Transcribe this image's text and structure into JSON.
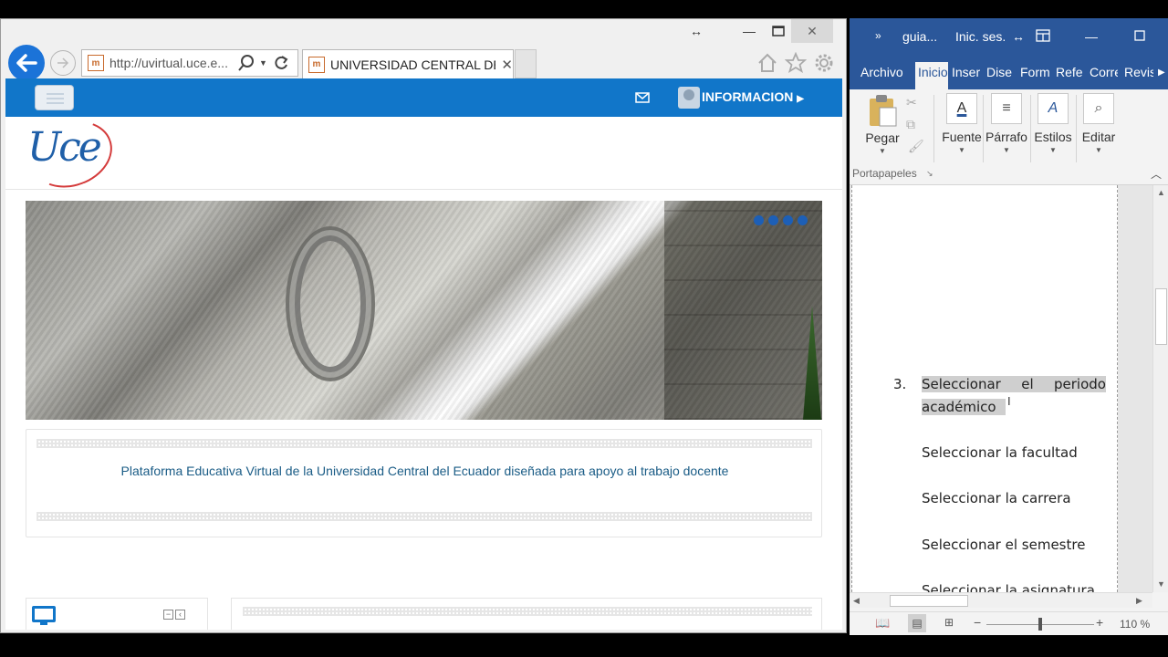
{
  "browser": {
    "address": "http://uvirtual.uce.e...",
    "tab_title": "UNIVERSIDAD CENTRAL DE...",
    "favicon_text": "m"
  },
  "site": {
    "nav_label": "INFORMACION",
    "logo_text": "Uce",
    "tagline": "Plataforma Educativa Virtual de la Universidad Central del Ecuador diseñada para apoyo al trabajo docente",
    "accent": "#1176c9"
  },
  "word": {
    "title_file": "guia...",
    "title_signin": "Inic. ses.",
    "tabs": [
      "Archivo",
      "Inicio",
      "Inser",
      "Dise",
      "Form",
      "Refe",
      "Corre",
      "Revis"
    ],
    "ribbon": {
      "paste": "Pegar",
      "font": "Fuente",
      "paragraph": "Párrafo",
      "styles": "Estilos",
      "edit": "Editar",
      "clipboard_group": "Portapapeles"
    },
    "doc": {
      "item_number": "3.",
      "line1_words": [
        "Seleccionar",
        "el",
        "periodo"
      ],
      "line1b": "académico",
      "lines": [
        "Seleccionar la facultad",
        "Seleccionar la carrera",
        "Seleccionar el semestre",
        "Seleccionar la asignatura"
      ]
    },
    "zoom": "110 %",
    "accent": "#2b579a"
  }
}
